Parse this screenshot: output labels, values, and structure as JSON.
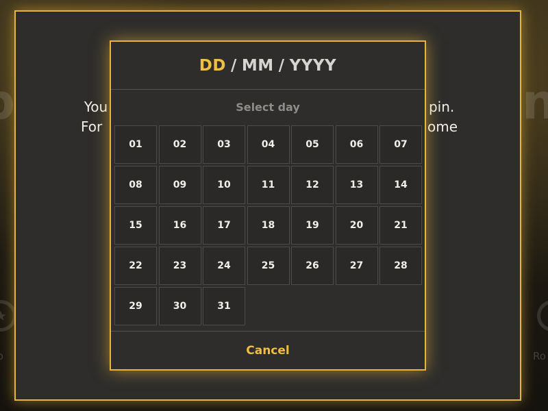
{
  "background": {
    "left_word": "p",
    "right_word": "ns",
    "left_label": "Ro",
    "right_label": "Ro"
  },
  "modal": {
    "line1_left": "You",
    "line1_right": "pin.",
    "line2_left": "For",
    "line2_right": "ome"
  },
  "picker": {
    "header": {
      "day": "DD",
      "sep1": "/",
      "month": "MM",
      "sep2": "/",
      "year": "YYYY"
    },
    "select_label": "Select day",
    "days": [
      "01",
      "02",
      "03",
      "04",
      "05",
      "06",
      "07",
      "08",
      "09",
      "10",
      "11",
      "12",
      "13",
      "14",
      "15",
      "16",
      "17",
      "18",
      "19",
      "20",
      "21",
      "22",
      "23",
      "24",
      "25",
      "26",
      "27",
      "28",
      "29",
      "30",
      "31"
    ],
    "cancel_label": "Cancel"
  },
  "colors": {
    "accent": "#f0bf40",
    "panel": "#2e2d2b",
    "border": "#e8b53a"
  }
}
